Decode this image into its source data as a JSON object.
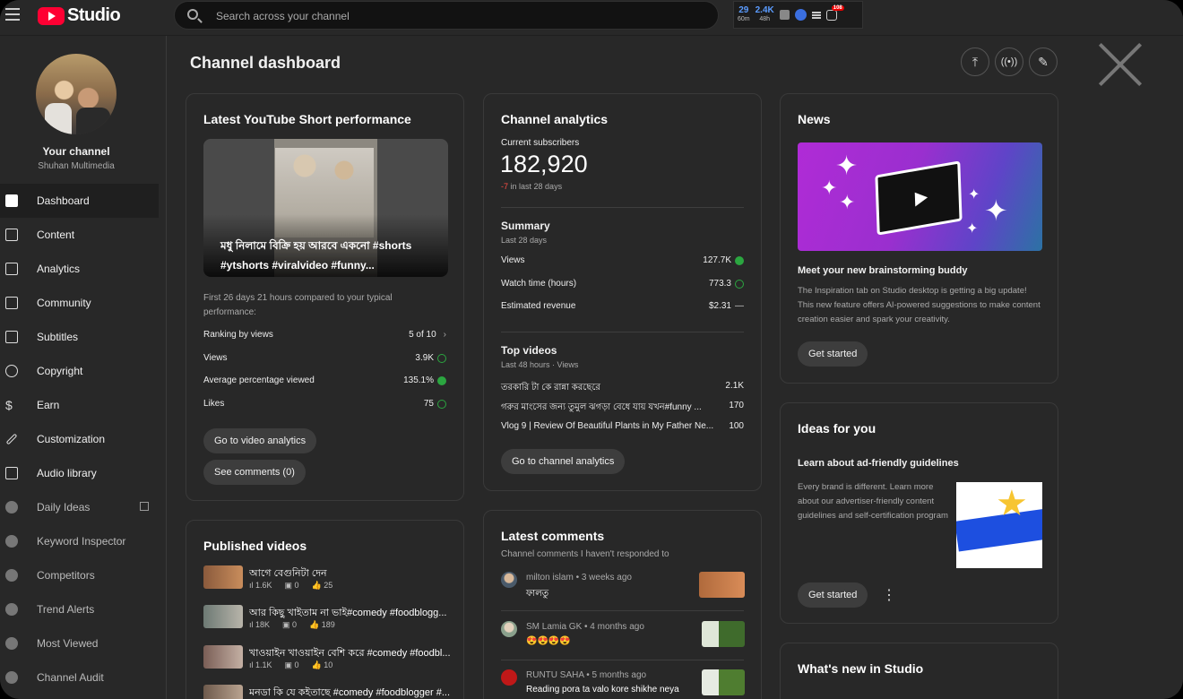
{
  "app": {
    "name": "Studio",
    "search_placeholder": "Search across your channel"
  },
  "ext": {
    "a": "29",
    "a_sub": "60m",
    "b": "2.4K",
    "b_sub": "48h",
    "badge": "108"
  },
  "channel": {
    "label": "Your channel",
    "name": "Shuhan Multimedia"
  },
  "nav": [
    {
      "label": "Dashboard",
      "icon": "dashboard-icon"
    },
    {
      "label": "Content",
      "icon": "content-icon"
    },
    {
      "label": "Analytics",
      "icon": "analytics-icon"
    },
    {
      "label": "Community",
      "icon": "community-icon"
    },
    {
      "label": "Subtitles",
      "icon": "subtitles-icon"
    },
    {
      "label": "Copyright",
      "icon": "copyright-icon"
    },
    {
      "label": "Earn",
      "icon": "dollar-icon"
    },
    {
      "label": "Customization",
      "icon": "magic-wand-icon"
    },
    {
      "label": "Audio library",
      "icon": "audio-library-icon"
    },
    {
      "label": "Daily Ideas",
      "icon": "extension-icon"
    },
    {
      "label": "Keyword Inspector",
      "icon": "extension-icon"
    },
    {
      "label": "Competitors",
      "icon": "extension-icon"
    },
    {
      "label": "Trend Alerts",
      "icon": "extension-icon"
    },
    {
      "label": "Most Viewed",
      "icon": "extension-icon"
    },
    {
      "label": "Channel Audit",
      "icon": "extension-icon"
    }
  ],
  "page_title": "Channel dashboard",
  "short": {
    "title": "Latest YouTube Short performance",
    "caption": "মধু নিলামে বিক্রি হয় আরবে একনো #shorts #ytshorts #viralvideo #funny...",
    "compare": "First 26 days 21 hours compared to your typical performance:",
    "rows": [
      {
        "label": "Ranking by views",
        "value": "5 of 10"
      },
      {
        "label": "Views",
        "value": "3.9K"
      },
      {
        "label": "Average percentage viewed",
        "value": "135.1%"
      },
      {
        "label": "Likes",
        "value": "75"
      }
    ],
    "btn_analytics": "Go to video analytics",
    "btn_comments": "See comments (0)"
  },
  "analytics": {
    "title": "Channel analytics",
    "subs_label": "Current subscribers",
    "subs": "182,920",
    "subs_change": "-7",
    "subs_change_tail": "in last 28 days",
    "summary": "Summary",
    "summary_period": "Last 28 days",
    "rows": [
      {
        "label": "Views",
        "value": "127.7K"
      },
      {
        "label": "Watch time (hours)",
        "value": "773.3"
      },
      {
        "label": "Estimated revenue",
        "value": "$2.31"
      }
    ],
    "top": "Top videos",
    "top_period": "Last 48 hours · Views",
    "videos": [
      {
        "title": "তরকারি টা কে রান্না করছেরে",
        "views": "2.1K"
      },
      {
        "title": "গরুর মাংসের জন্য তুমুল ঝগড়া বেধে যায় যখন#funny ...",
        "views": "170"
      },
      {
        "title": "Vlog 9 | Review Of Beautiful Plants in My Father Ne...",
        "views": "100"
      }
    ],
    "btn": "Go to channel analytics"
  },
  "news": {
    "title": "News",
    "headline": "Meet your new brainstorming buddy",
    "body": "The Inspiration tab on Studio desktop is getting a big update! This new feature offers AI-powered suggestions to make content creation easier and spark your creativity.",
    "btn": "Get started"
  },
  "ideas": {
    "title": "Ideas for you",
    "headline": "Learn about ad-friendly guidelines",
    "body": "Every brand is different. Learn more about our advertiser-friendly content guidelines and self-certification program",
    "btn": "Get started"
  },
  "whatsnew": {
    "title": "What's new in Studio"
  },
  "published": {
    "title": "Published videos",
    "videos": [
      {
        "title": "আগে বেগুনিটা দেন",
        "views": "1.6K",
        "comments": "0",
        "likes": "25"
      },
      {
        "title": "আর কিছু খাইতাম না ভাই#comedy #foodblogg...",
        "views": "18K",
        "comments": "0",
        "likes": "189"
      },
      {
        "title": "খাওয়াইন খাওয়াইন বেশি করে #comedy #foodbl...",
        "views": "1.1K",
        "comments": "0",
        "likes": "10"
      },
      {
        "title": "মনডা কি যে কইতাছে #comedy #foodblogger #...",
        "views": "",
        "comments": "",
        "likes": ""
      }
    ]
  },
  "comments": {
    "title": "Latest comments",
    "subtitle": "Channel comments I haven't responded to",
    "items": [
      {
        "author": "milton islam • 3 weeks ago",
        "text": "ফালতু"
      },
      {
        "author": "SM Lamia GK • 4 months ago",
        "text": "😍😍😍😍"
      },
      {
        "author": "RUNTU SAHA • 5 months ago",
        "text": "Reading pora ta valo kore shikhe neya"
      }
    ]
  }
}
